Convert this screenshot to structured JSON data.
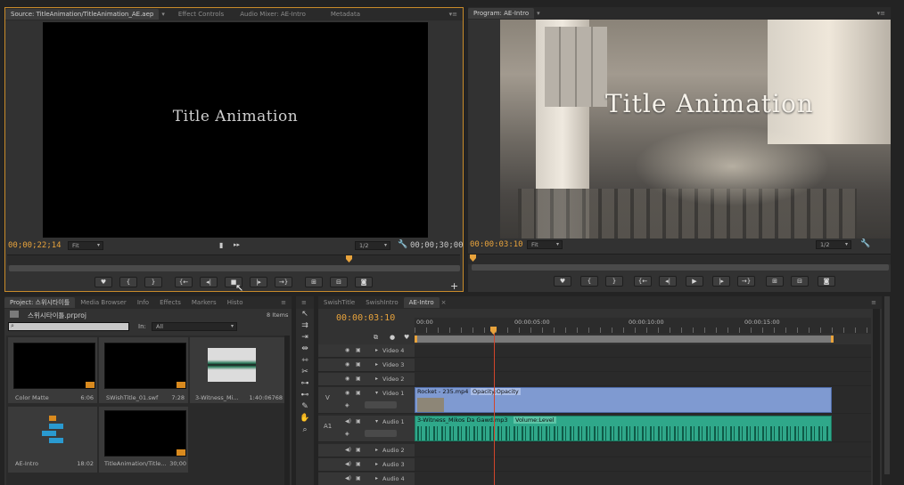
{
  "source_monitor": {
    "tabs": [
      "Source: TitleAnimation/TitleAnimation_AE.aep",
      "Effect Controls",
      "Audio Mixer: AE-Intro",
      "Metadata"
    ],
    "title_text": "Title Animation",
    "timecode_current": "00;00;22;14",
    "timecode_duration": "00;00;30;00",
    "zoom": "Fit",
    "resolution": "1/2"
  },
  "program_monitor": {
    "tabs": [
      "Program: AE-Intro"
    ],
    "title_text": "Title Animation",
    "timecode_current": "00:00:03:10",
    "zoom": "Fit",
    "resolution": "1/2"
  },
  "project_panel": {
    "tabs": [
      "Project: 스위시타이틀",
      "Media Browser",
      "Info",
      "Effects",
      "Markers",
      "Histo"
    ],
    "project_file": "스위시타이틀.prproj",
    "items_count": "8 Items",
    "search_placeholder": "",
    "in_label": "In:",
    "in_value": "All",
    "items": [
      {
        "name": "Color Matte",
        "duration": "6:06"
      },
      {
        "name": "SWishTitle_01.swf",
        "duration": "7:28"
      },
      {
        "name": "3-Witness_Mi...",
        "duration": "1:40:06768"
      },
      {
        "name": "AE-Intro",
        "duration": "18:02"
      },
      {
        "name": "TitleAnimation/Title...",
        "duration": "30;00"
      }
    ]
  },
  "timeline": {
    "tabs": [
      "SwishTitle",
      "SwishIntro",
      "AE-Intro"
    ],
    "timecode": "00:00:03:10",
    "ruler_labels": [
      "00:00",
      "00:00:05:00",
      "00:00:10:00",
      "00:00:15:00"
    ],
    "tracks": {
      "video": [
        "Video 4",
        "Video 3",
        "Video 2",
        "Video 1"
      ],
      "audio": [
        "Audio 1",
        "Audio 2",
        "Audio 3",
        "Audio 4"
      ]
    },
    "v_label": "V",
    "a_label": "A1",
    "video_clip": "Rocket - 235.mp4",
    "video_fx": "Opacity:Opacity",
    "audio_clip": "3-Witness_Mikos Da Gawd.mp3",
    "audio_fx": "Volume:Level"
  },
  "colors": {
    "accent_timecode": "#e8a33c",
    "video_clip": "#7f9ad1",
    "audio_clip": "#2fa88a",
    "playhead": "#d1452b"
  }
}
